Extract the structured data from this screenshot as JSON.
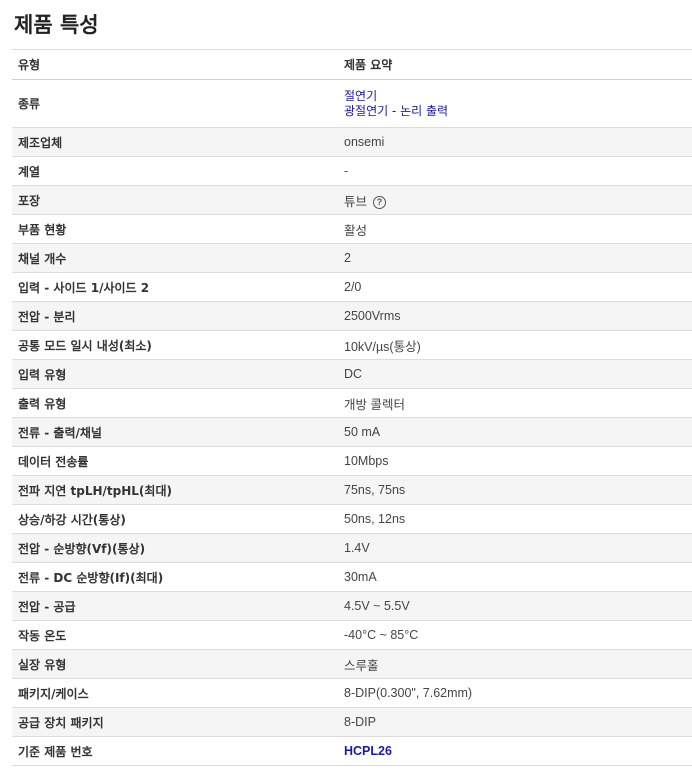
{
  "page": {
    "title": "제품 특성"
  },
  "table": {
    "header": {
      "label": "유형",
      "value": "제품 요약"
    },
    "category": {
      "label": "종류",
      "links": [
        "절연기",
        "광절연기 - 논리 출력"
      ]
    },
    "rows": [
      {
        "label": "제조업체",
        "value": "onsemi"
      },
      {
        "label": "계열",
        "value": "-"
      },
      {
        "label": "포장",
        "value": "튜브"
      },
      {
        "label": "부품 현황",
        "value": "활성"
      },
      {
        "label": "채널 개수",
        "value": "2"
      },
      {
        "label": "입력 - 사이드 1/사이드 2",
        "value": "2/0"
      },
      {
        "label": "전압 - 분리",
        "value": "2500Vrms"
      },
      {
        "label": "공통 모드 일시 내성(최소)",
        "value": "10kV/µs(통상)"
      },
      {
        "label": "입력 유형",
        "value": "DC"
      },
      {
        "label": "출력 유형",
        "value": "개방 콜렉터"
      },
      {
        "label": "전류 - 출력/채널",
        "value": "50 mA"
      },
      {
        "label": "데이터 전송률",
        "value": "10Mbps"
      },
      {
        "label": "전파 지연 tpLH/tpHL(최대)",
        "value": "75ns, 75ns"
      },
      {
        "label": "상승/하강 시간(통상)",
        "value": "50ns, 12ns"
      },
      {
        "label": "전압 - 순방향(Vf)(통상)",
        "value": "1.4V"
      },
      {
        "label": "전류 - DC 순방향(If)(최대)",
        "value": "30mA"
      },
      {
        "label": "전압 - 공급",
        "value": "4.5V ~ 5.5V"
      },
      {
        "label": "작동 온도",
        "value": "-40°C ~ 85°C"
      },
      {
        "label": "실장 유형",
        "value": "스루홀"
      },
      {
        "label": "패키지/케이스",
        "value": "8-DIP(0.300\", 7.62mm)"
      },
      {
        "label": "공급 장치 패키지",
        "value": "8-DIP"
      },
      {
        "label": "기준 제품 번호",
        "value": "HCPL26"
      }
    ],
    "help_icon_glyph": "?",
    "link_color": "#1a1aa6"
  }
}
